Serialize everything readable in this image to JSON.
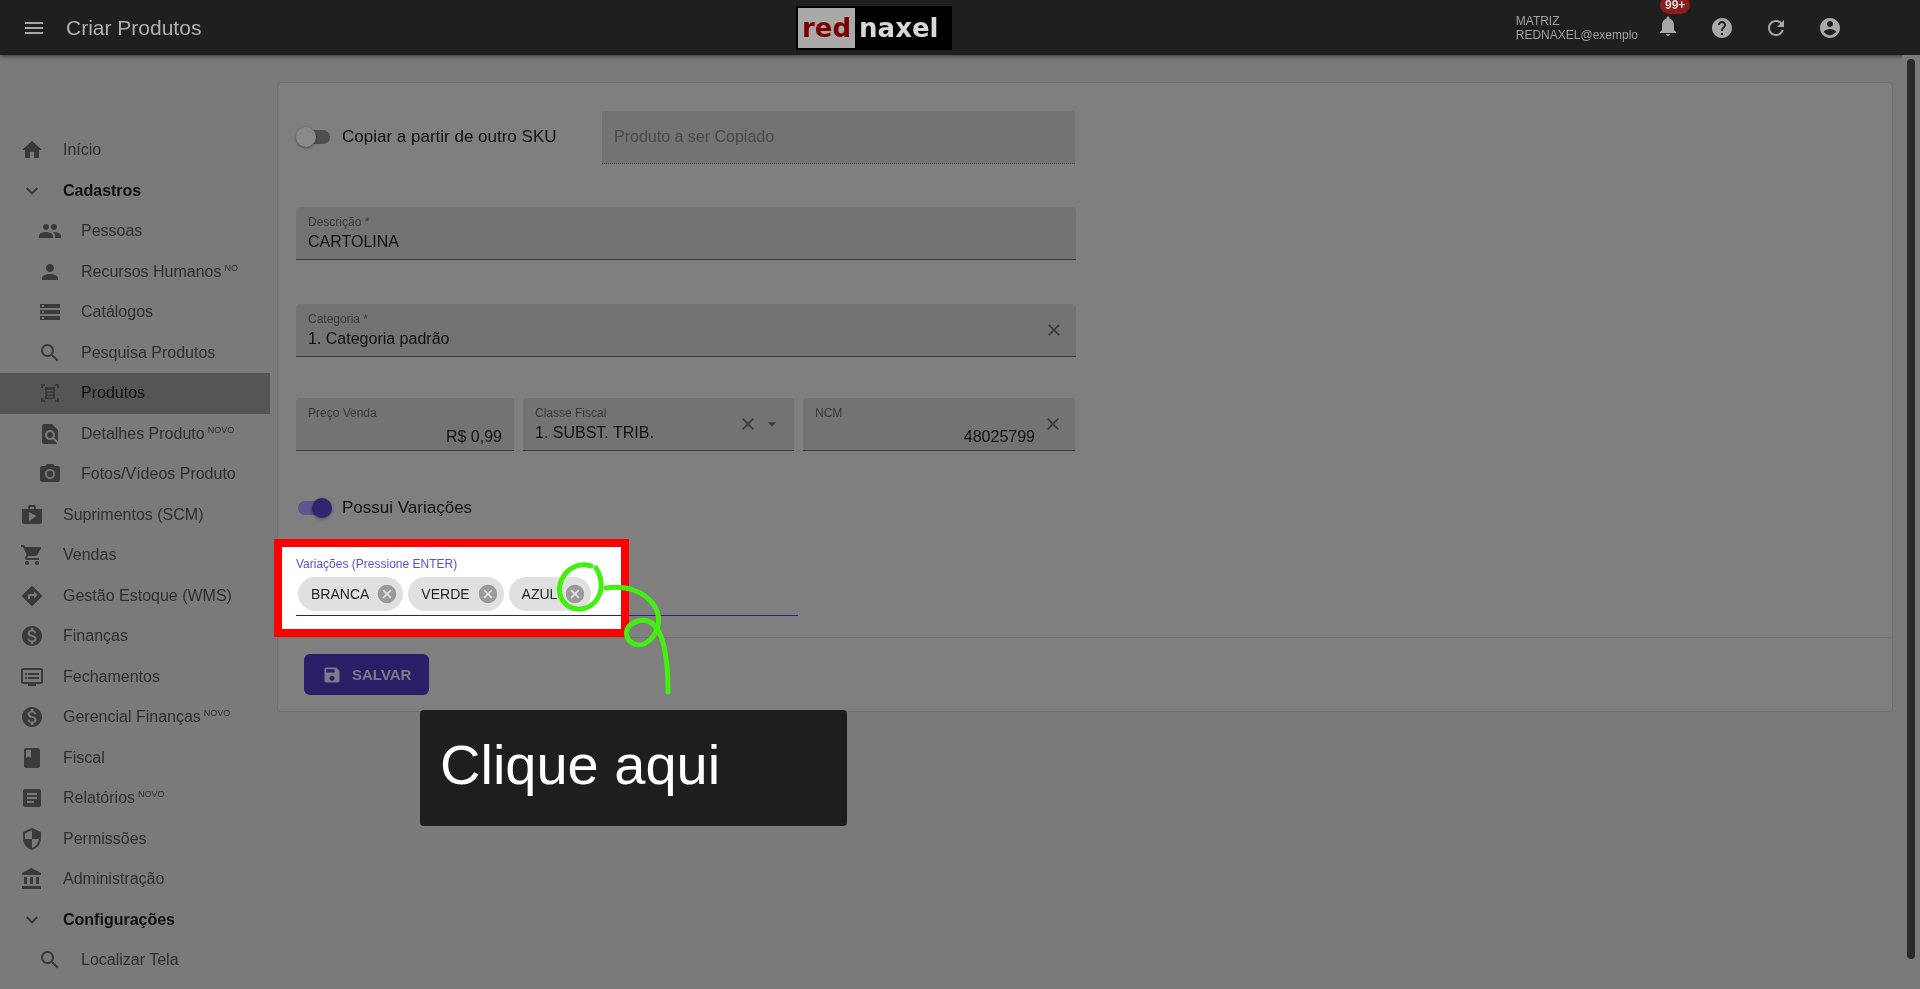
{
  "app_bar": {
    "title": "Criar Produtos",
    "logo": {
      "part_1": "red",
      "part_2": "naxel"
    },
    "account": {
      "line_1": "MATRIZ",
      "line_2": "REDNAXEL@exemplo"
    },
    "notifications_badge": "99+"
  },
  "sidebar": {
    "items": [
      {
        "label": "Início",
        "selected": false
      },
      {
        "label": "Cadastros",
        "selected": false,
        "expanded": true,
        "children": [
          {
            "label": "Pessoas",
            "selected": false
          },
          {
            "label": "Recursos Humanos",
            "badge": "NO",
            "selected": false
          },
          {
            "label": "Catálogos",
            "selected": false
          },
          {
            "label": "Pesquisa Produtos",
            "selected": false
          },
          {
            "label": "Produtos",
            "selected": true
          },
          {
            "label": "Detalhes Produto",
            "badge": "NOVO",
            "selected": false
          },
          {
            "label": "Fotos/Vídeos Produto",
            "selected": false
          }
        ]
      },
      {
        "label": "Suprimentos (SCM)",
        "selected": false
      },
      {
        "label": "Vendas",
        "selected": false
      },
      {
        "label": "Gestão Estoque (WMS)",
        "selected": false
      },
      {
        "label": "Finanças",
        "selected": false
      },
      {
        "label": "Fechamentos",
        "selected": false
      },
      {
        "label": "Gerencial Finanças",
        "badge": "NOVO",
        "selected": false
      },
      {
        "label": "Fiscal",
        "selected": false
      },
      {
        "label": "Relatórios",
        "badge": "NOVO",
        "selected": false
      },
      {
        "label": "Permissões",
        "selected": false
      },
      {
        "label": "Administração",
        "selected": false
      },
      {
        "label": "Configurações",
        "selected": false,
        "expanded": true,
        "children": [
          {
            "label": "Localizar Tela",
            "selected": false
          }
        ]
      }
    ]
  },
  "form": {
    "copy_toggle": {
      "label": "Copiar a partir de outro SKU",
      "on": false
    },
    "copy_source": {
      "placeholder": "Produto a ser Copiado",
      "disabled": true
    },
    "description": {
      "label": "Descrição *",
      "value": "CARTOLINA"
    },
    "category": {
      "label": "Categoria *",
      "value": "1. Categoria padrão",
      "clearable": true
    },
    "fields_row": [
      {
        "kind": "amount",
        "label": "Preço Venda",
        "value": "R$ 0,99"
      },
      {
        "kind": "select",
        "label": "Classe Fiscal",
        "value": "1. SUBST. TRIB."
      },
      {
        "kind": "code",
        "label": "NCM",
        "value": "48025799"
      }
    ],
    "variations_toggle": {
      "label": "Possui Variações",
      "on": true
    },
    "variations": {
      "label": "Variações (Pressione ENTER)",
      "chips": [
        {
          "label": "BRANCA"
        },
        {
          "label": "VERDE"
        },
        {
          "label": "AZUL"
        }
      ]
    },
    "save_button": "SALVAR"
  },
  "callout": "Clique aqui"
}
